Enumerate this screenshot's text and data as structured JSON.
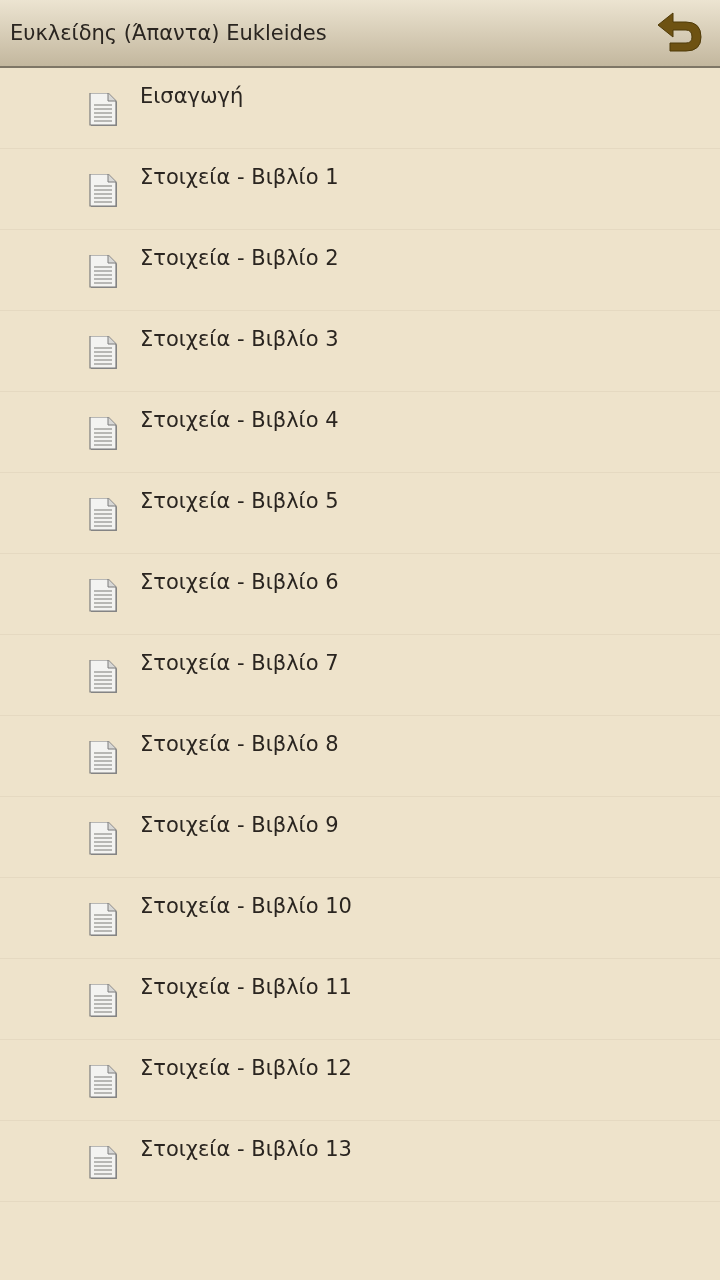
{
  "header": {
    "title": "Ευκλείδης (Άπαντα) Eukleides"
  },
  "items": [
    {
      "title": "Εισαγωγή"
    },
    {
      "title": "Στοιχεία - Βιβλίο 1"
    },
    {
      "title": "Στοιχεία - Βιβλίο 2"
    },
    {
      "title": "Στοιχεία - Βιβλίο 3"
    },
    {
      "title": "Στοιχεία - Βιβλίο 4"
    },
    {
      "title": "Στοιχεία - Βιβλίο 5"
    },
    {
      "title": "Στοιχεία - Βιβλίο 6"
    },
    {
      "title": "Στοιχεία - Βιβλίο 7"
    },
    {
      "title": "Στοιχεία - Βιβλίο 8"
    },
    {
      "title": "Στοιχεία - Βιβλίο 9"
    },
    {
      "title": "Στοιχεία - Βιβλίο 10"
    },
    {
      "title": "Στοιχεία - Βιβλίο 11"
    },
    {
      "title": "Στοιχεία - Βιβλίο 12"
    },
    {
      "title": "Στοιχεία - Βιβλίο 13"
    }
  ]
}
